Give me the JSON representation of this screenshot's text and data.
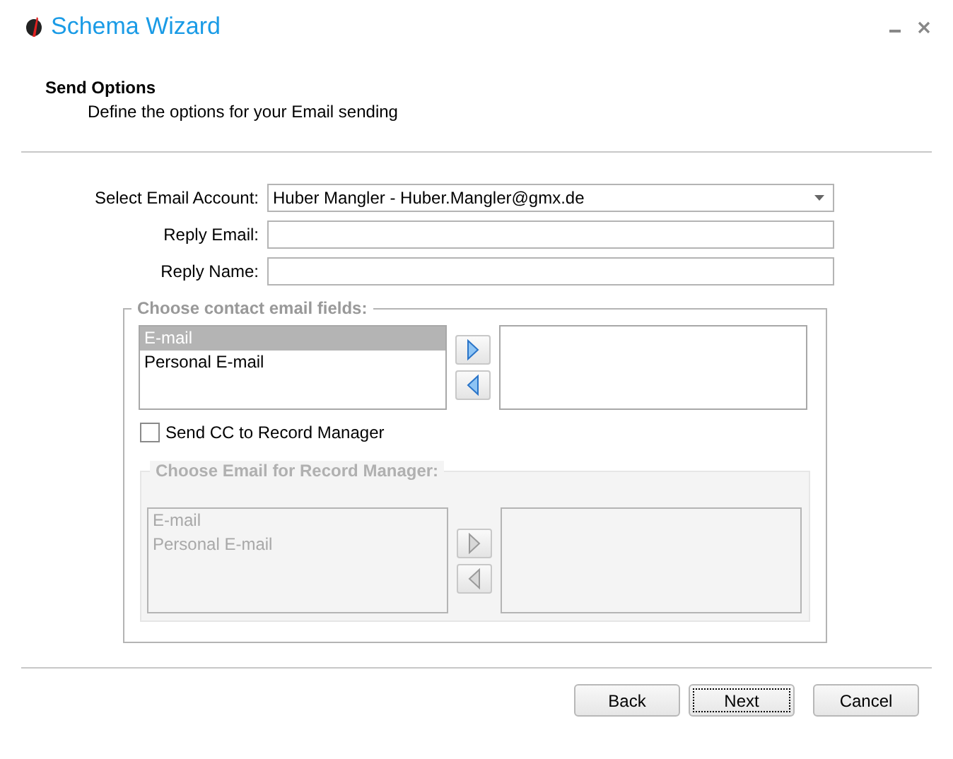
{
  "window": {
    "title": "Schema Wizard"
  },
  "header": {
    "title": "Send Options",
    "subtitle": "Define the options for your Email sending"
  },
  "form": {
    "fields": [
      {
        "kind": "select",
        "label": "Select Email Account:",
        "value": "Huber Mangler - Huber.Mangler@gmx.de"
      },
      {
        "kind": "text",
        "label": "Reply Email:"
      },
      {
        "kind": "text",
        "label": "Reply Name:"
      }
    ]
  },
  "contact_fields": {
    "title": "Choose contact email fields:",
    "disabled": false,
    "available": [
      {
        "label": "E-mail",
        "selected": true
      },
      {
        "label": "Personal E-mail",
        "selected": false
      }
    ]
  },
  "cc_checkbox": {
    "label": "Send CC to Record Manager",
    "checked": false
  },
  "record_manager_fields": {
    "title": "Choose Email for Record Manager:",
    "disabled": true,
    "available": [
      {
        "label": "E-mail",
        "selected": false
      },
      {
        "label": "Personal E-mail",
        "selected": false
      }
    ]
  },
  "buttons": [
    {
      "label": "Back",
      "focused": false
    },
    {
      "label": "Next",
      "focused": true
    },
    {
      "label": "Cancel",
      "focused": false
    }
  ]
}
